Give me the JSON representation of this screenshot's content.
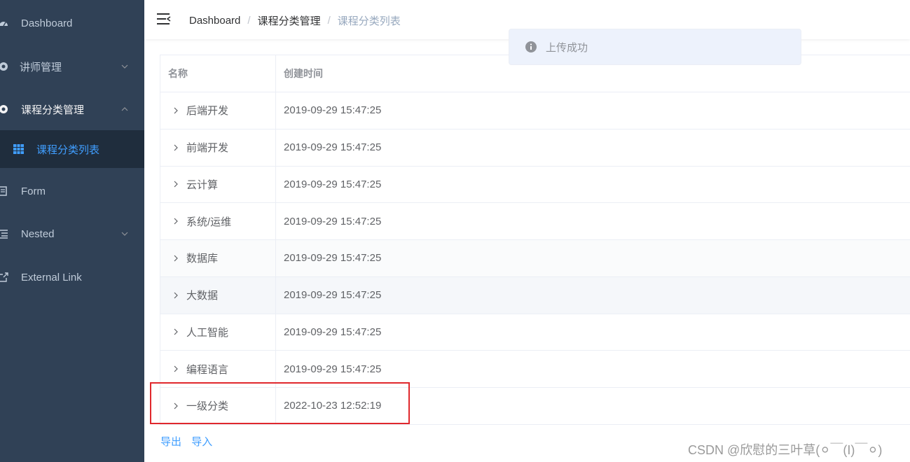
{
  "sidebar": {
    "background": "#304156",
    "items": [
      {
        "label": "Dashboard",
        "icon": "dashboard-icon"
      },
      {
        "label": "讲师管理",
        "icon": "teacher-icon",
        "arrow": "chevron-down-icon"
      },
      {
        "label": "课程分类管理",
        "icon": "subject-icon",
        "arrow": "chevron-up-icon"
      },
      {
        "label": "Form",
        "icon": "form-icon"
      },
      {
        "label": "Nested",
        "icon": "nested-icon",
        "arrow": "chevron-down-icon"
      },
      {
        "label": "External Link",
        "icon": "link-icon"
      }
    ],
    "submenu": [
      {
        "label": "课程分类列表",
        "icon": "table-icon",
        "active": true
      }
    ]
  },
  "navbar": {
    "breadcrumb": [
      "Dashboard",
      "课程分类管理",
      "课程分类列表"
    ],
    "separator": "/"
  },
  "table": {
    "headers": [
      "名称",
      "创建时间"
    ],
    "rows": [
      {
        "name": "后端开发",
        "created": "2019-09-29 15:47:25"
      },
      {
        "name": "前端开发",
        "created": "2019-09-29 15:47:25"
      },
      {
        "name": "云计算",
        "created": "2019-09-29 15:47:25"
      },
      {
        "name": "系统/运维",
        "created": "2019-09-29 15:47:25"
      },
      {
        "name": "数据库",
        "created": "2019-09-29 15:47:25"
      },
      {
        "name": "大数据",
        "created": "2019-09-29 15:47:25"
      },
      {
        "name": "人工智能",
        "created": "2019-09-29 15:47:25"
      },
      {
        "name": "编程语言",
        "created": "2019-09-29 15:47:25"
      },
      {
        "name": "一级分类",
        "created": "2022-10-23 12:52:19"
      }
    ]
  },
  "actions": {
    "export": "导出",
    "import": "导入"
  },
  "message": {
    "text": "上传成功",
    "icon": "info-icon"
  },
  "watermark": "CSDN @欣慰的三叶草(⚪￣(I)￣⚪)",
  "colors": {
    "accent": "#409eff",
    "highlight": "#e0282d"
  }
}
